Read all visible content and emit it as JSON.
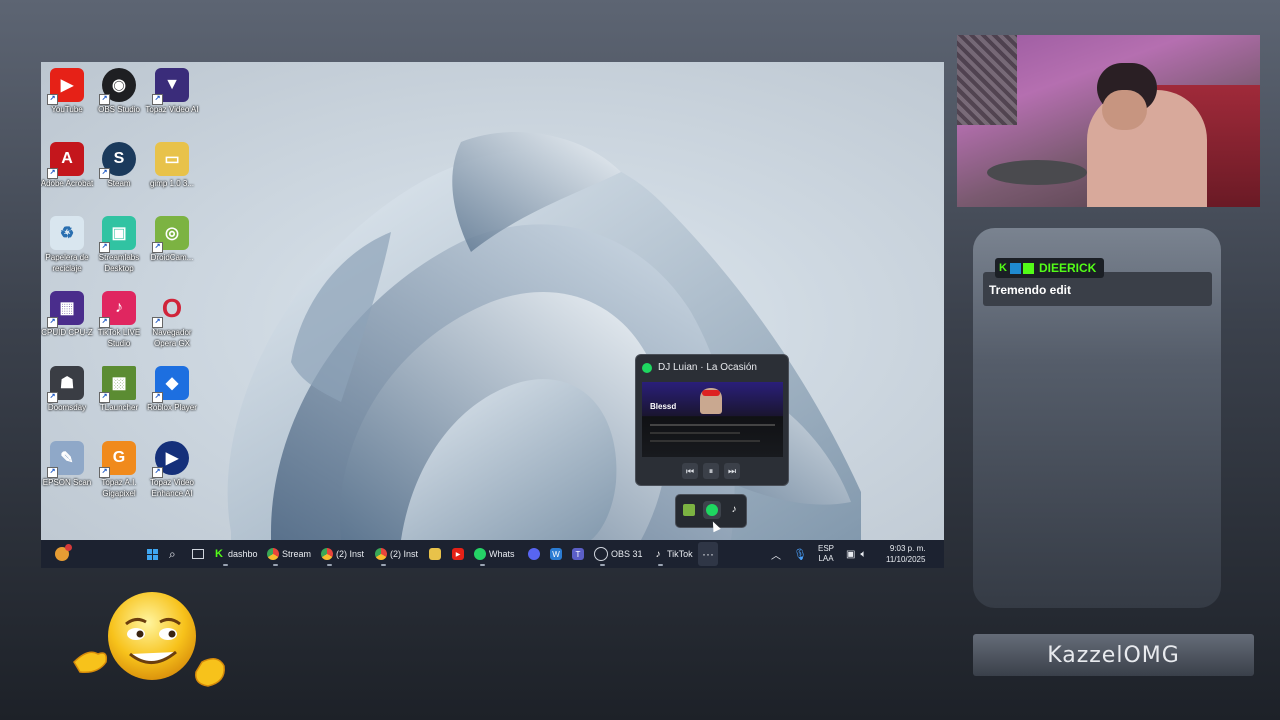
{
  "desktop": {
    "icons": [
      {
        "label": "YouTube",
        "color": "#e62117",
        "glyph": "▶"
      },
      {
        "label": "OBS Studio",
        "color": "#1e1f22",
        "glyph": "◉"
      },
      {
        "label": "Topaz Video AI",
        "color": "#3a2c7a",
        "glyph": "▼"
      },
      {
        "label": "Adobe Acrobat",
        "color": "#c4161c",
        "glyph": "A"
      },
      {
        "label": "Steam",
        "color": "#1b3a5c",
        "glyph": "S"
      },
      {
        "label": "gimp 1.0 3...",
        "color": "#e8c24a",
        "glyph": "▭"
      },
      {
        "label": "Papelera de reciclaje",
        "color": "#d9e6ef",
        "glyph": "♻"
      },
      {
        "label": "Streamlabs Desktop",
        "color": "#31c3a2",
        "glyph": "▣"
      },
      {
        "label": "DroidCam...",
        "color": "#7cb342",
        "glyph": "◎"
      },
      {
        "label": "CPUID CPU-Z",
        "color": "#4a2d8c",
        "glyph": "▦"
      },
      {
        "label": "TikTok LIVE Studio",
        "color": "#e02660",
        "glyph": "♪"
      },
      {
        "label": "Navegador Opera GX",
        "color": "#f2f2f2",
        "glyph": "O"
      },
      {
        "label": "Doomsday",
        "color": "#3a3d44",
        "glyph": "☗"
      },
      {
        "label": "TLauncher",
        "color": "#5b8c32",
        "glyph": "▩"
      },
      {
        "label": "Roblox Player",
        "color": "#1d6fe0",
        "glyph": "◆"
      },
      {
        "label": "EPSON Scan",
        "color": "#8fa8c8",
        "glyph": "✎"
      },
      {
        "label": "Topaz A.I. Gigapixel",
        "color": "#f08a1c",
        "glyph": "G"
      },
      {
        "label": "Topaz Video Enhance AI",
        "color": "#15307a",
        "glyph": "▶"
      }
    ]
  },
  "taskbar": {
    "apps": [
      {
        "label": "dashbo",
        "icon": "kick-icon",
        "color": "#53fc18"
      },
      {
        "label": "Stream",
        "icon": "chrome-icon",
        "color": "#e8453c"
      },
      {
        "label": "(2) Inst",
        "icon": "chrome-icon",
        "color": "#e8453c"
      },
      {
        "label": "(2) Inst",
        "icon": "chrome-icon",
        "color": "#e8453c"
      }
    ],
    "whatsapp_label": "Whats",
    "obs_label": "OBS 31",
    "tiktok_label": "TikTok",
    "lang_top": "ESP",
    "lang_bottom": "LAA",
    "time": "9:03 p. m.",
    "date": "11/10/2025"
  },
  "media": {
    "title": "DJ Luian · La Ocasión",
    "thumb_text": "Blessd"
  },
  "chat": {
    "username": "DIEERICK",
    "message": "Tremendo edit"
  },
  "streamer": {
    "name": "KazzelOMG"
  }
}
